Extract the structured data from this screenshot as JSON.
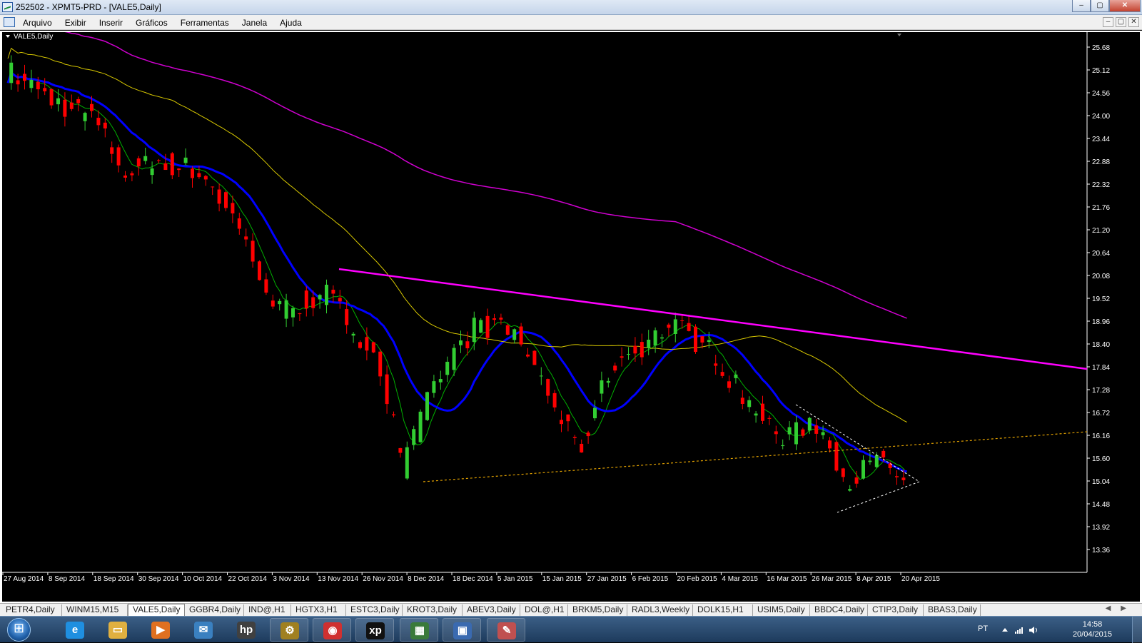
{
  "window": {
    "title": "252502 - XPMT5-PRD - [VALE5,Daily]",
    "controls": [
      "–",
      "▢",
      "✕"
    ]
  },
  "menu": {
    "items": [
      "Arquivo",
      "Exibir",
      "Inserir",
      "Gráficos",
      "Ferramentas",
      "Janela",
      "Ajuda"
    ],
    "mdi_controls": [
      "–",
      "▢",
      "✕"
    ]
  },
  "chart": {
    "label": "VALE5,Daily",
    "price_labels": [
      "25.68",
      "25.12",
      "24.56",
      "24.00",
      "23.44",
      "22.88",
      "22.32",
      "21.76",
      "21.20",
      "20.64",
      "20.08",
      "19.52",
      "18.96",
      "18.40",
      "17.84",
      "17.28",
      "16.72",
      "16.16",
      "15.60",
      "15.04",
      "14.48",
      "13.92",
      "13.36"
    ],
    "date_labels": [
      "27 Aug 2014",
      "8 Sep 2014",
      "18 Sep 2014",
      "30 Sep 2014",
      "10 Oct 2014",
      "22 Oct 2014",
      "3 Nov 2014",
      "13 Nov 2014",
      "26 Nov 2014",
      "8 Dec 2014",
      "18 Dec 2014",
      "5 Jan 2015",
      "15 Jan 2015",
      "27 Jan 2015",
      "6 Feb 2015",
      "20 Feb 2015",
      "4 Mar 2015",
      "16 Mar 2015",
      "26 Mar 2015",
      "8 Apr 2015",
      "20 Apr 2015"
    ],
    "colors": {
      "background": "#000000",
      "bull": "#32cd32",
      "bear": "#ff0000",
      "ma_fast": "#00b000",
      "ma_mid": "#0000ff",
      "ma_slow": "#d8c800",
      "ma_long": "#d000d0",
      "trendline": "#ff00ff",
      "support": "#e0a000",
      "wedge": "#ffffff"
    }
  },
  "symbol_tabs": [
    "PETR4,Daily",
    "WINM15,M15",
    "VALE5,Daily",
    "GGBR4,Daily",
    "IND@,H1",
    "HGTX3,H1",
    "ESTC3,Daily",
    "KROT3,Daily",
    "ABEV3,Daily",
    "DOL@,H1",
    "BRKM5,Daily",
    "RADL3,Weekly",
    "DOLK15,H1",
    "USIM5,Daily",
    "BBDC4,Daily",
    "CTIP3,Daily",
    "BBAS3,Daily"
  ],
  "active_tab": "VALE5,Daily",
  "taskbar": {
    "apps": [
      {
        "name": "ie-icon",
        "glyph": "e",
        "color": "#1f8fe0"
      },
      {
        "name": "explorer-icon",
        "glyph": "▭",
        "color": "#e0b040"
      },
      {
        "name": "media-player-icon",
        "glyph": "▶",
        "color": "#e07020"
      },
      {
        "name": "mail-icon",
        "glyph": "✉",
        "color": "#3a80c0"
      },
      {
        "name": "hp-icon",
        "glyph": "hp",
        "color": "#404040"
      },
      {
        "name": "tools-icon",
        "glyph": "⚙",
        "color": "#a08020"
      },
      {
        "name": "chrome-icon",
        "glyph": "◉",
        "color": "#d03030"
      },
      {
        "name": "xp-icon",
        "glyph": "xp",
        "color": "#111111"
      },
      {
        "name": "metatrader-icon",
        "glyph": "▦",
        "color": "#3a7a3a"
      },
      {
        "name": "photo-viewer-icon",
        "glyph": "▣",
        "color": "#3a6ab0"
      },
      {
        "name": "paint-icon",
        "glyph": "✎",
        "color": "#c05050"
      }
    ],
    "language": "PT",
    "time": "14:58",
    "date": "20/04/2015"
  }
}
